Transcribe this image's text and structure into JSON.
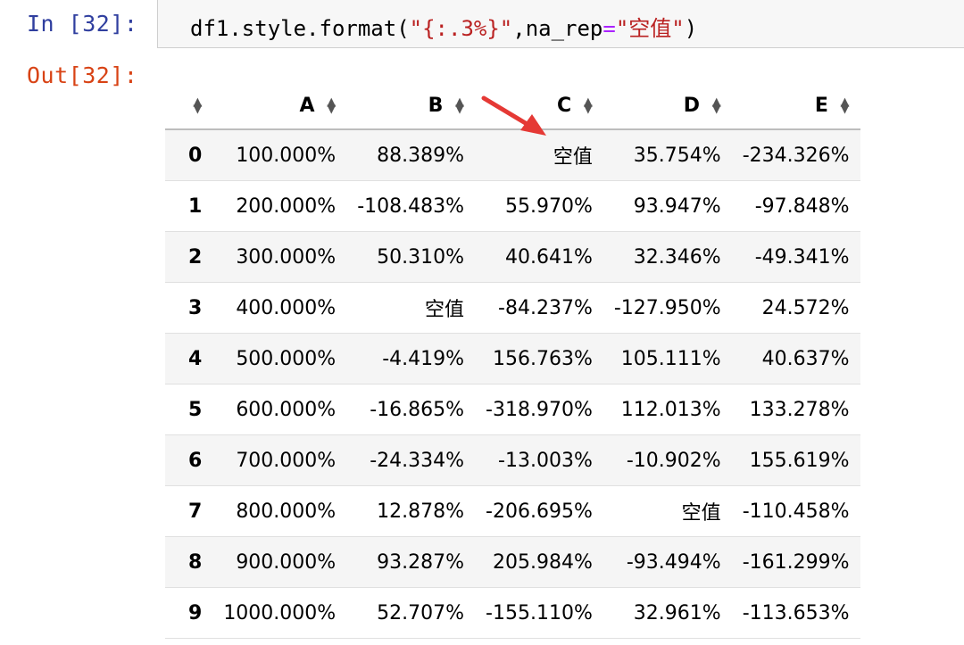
{
  "cell": {
    "in_prompt": "In [32]:",
    "out_prompt": "Out[32]:",
    "code": {
      "prefix": "df1.style.format(",
      "format_str": "\"{:.3%}\"",
      "comma": ",",
      "kw": "na_rep",
      "eq": "=",
      "na_str": "\"空值\"",
      "suffix": ")"
    }
  },
  "table": {
    "columns": [
      "A",
      "B",
      "C",
      "D",
      "E"
    ],
    "rows": [
      {
        "index": "0",
        "values": [
          "100.000%",
          "88.389%",
          "空值",
          "35.754%",
          "-234.326%"
        ]
      },
      {
        "index": "1",
        "values": [
          "200.000%",
          "-108.483%",
          "55.970%",
          "93.947%",
          "-97.848%"
        ]
      },
      {
        "index": "2",
        "values": [
          "300.000%",
          "50.310%",
          "40.641%",
          "32.346%",
          "-49.341%"
        ]
      },
      {
        "index": "3",
        "values": [
          "400.000%",
          "空值",
          "-84.237%",
          "-127.950%",
          "24.572%"
        ]
      },
      {
        "index": "4",
        "values": [
          "500.000%",
          "-4.419%",
          "156.763%",
          "105.111%",
          "40.637%"
        ]
      },
      {
        "index": "5",
        "values": [
          "600.000%",
          "-16.865%",
          "-318.970%",
          "112.013%",
          "133.278%"
        ]
      },
      {
        "index": "6",
        "values": [
          "700.000%",
          "-24.334%",
          "-13.003%",
          "-10.902%",
          "155.619%"
        ]
      },
      {
        "index": "7",
        "values": [
          "800.000%",
          "12.878%",
          "-206.695%",
          "空值",
          "-110.458%"
        ]
      },
      {
        "index": "8",
        "values": [
          "900.000%",
          "93.287%",
          "205.984%",
          "-93.494%",
          "-161.299%"
        ]
      },
      {
        "index": "9",
        "values": [
          "1000.000%",
          "52.707%",
          "-155.110%",
          "32.961%",
          "-113.653%"
        ]
      }
    ]
  },
  "icons": {
    "sort": "sort-icon",
    "annotation": "red-arrow-icon"
  },
  "colors": {
    "in_prompt": "#303f9f",
    "out_prompt": "#d84315",
    "string": "#ba2121",
    "operator": "#aa22ff",
    "arrow": "#e53935"
  }
}
